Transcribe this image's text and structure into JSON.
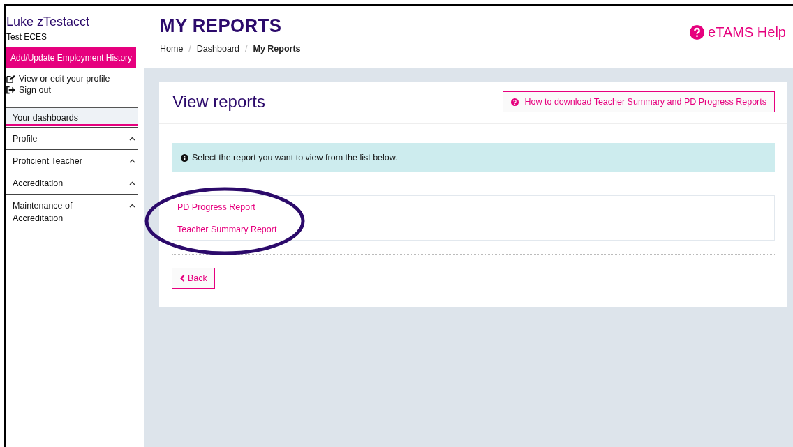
{
  "user": {
    "name": "Luke zTestacct",
    "role": "Test ECES"
  },
  "employment_button": "Add/Update Employment History",
  "profile_links": [
    {
      "kind": "edit",
      "label": "View or edit your profile"
    },
    {
      "kind": "signout",
      "label": "Sign out"
    }
  ],
  "dashboard_link": {
    "label": "Your dashboards",
    "selected": true
  },
  "nav": [
    {
      "label": "Profile"
    },
    {
      "label": "Proficient Teacher"
    },
    {
      "label": "Accreditation"
    },
    {
      "label": "Maintenance of Accreditation"
    }
  ],
  "page_title": "MY REPORTS",
  "breadcrumbs": [
    {
      "label": "Home",
      "current": false
    },
    {
      "label": "Dashboard",
      "current": false
    },
    {
      "label": "My Reports",
      "current": true
    }
  ],
  "breadcrumb_separator": "/",
  "help_link": "eTAMS Help",
  "card": {
    "title": "View reports",
    "help_button": "How to download Teacher Summary and PD Progress Reports",
    "info": "Select the report you want to view from the list below.",
    "reports": [
      "PD Progress Report",
      "Teacher Summary Report"
    ],
    "back_button": "Back"
  }
}
